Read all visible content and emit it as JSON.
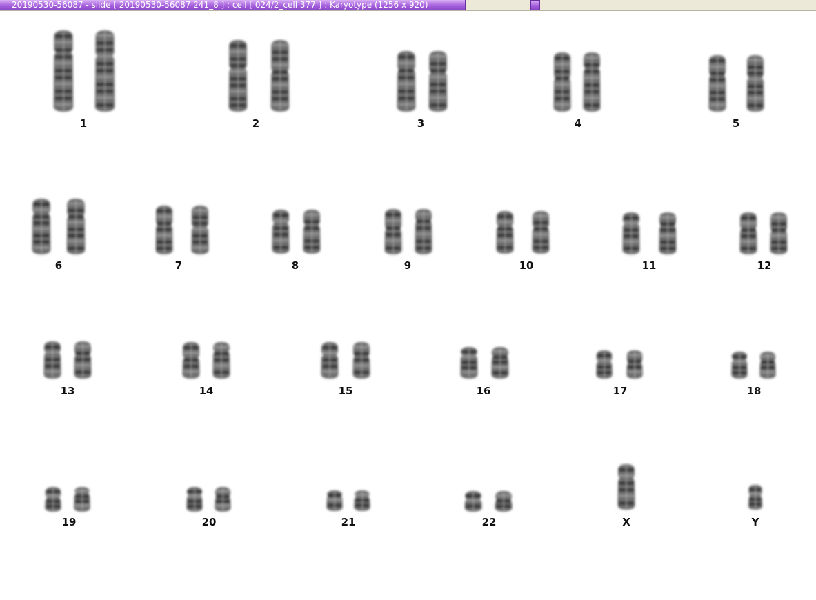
{
  "window": {
    "title": "20190530-56087 - slide [ 20190530-56087 241_8 ] : cell [ 024/2_cell 377 ] : Karyotype  (1256 x 920)"
  },
  "karyotype": {
    "labels": {
      "c1": "1",
      "c2": "2",
      "c3": "3",
      "c4": "4",
      "c5": "5",
      "c6": "6",
      "c7": "7",
      "c8": "8",
      "c9": "9",
      "c10": "10",
      "c11": "11",
      "c12": "12",
      "c13": "13",
      "c14": "14",
      "c15": "15",
      "c16": "16",
      "c17": "17",
      "c18": "18",
      "c19": "19",
      "c20": "20",
      "c21": "21",
      "c22": "22",
      "cX": "X",
      "cY": "Y"
    }
  }
}
